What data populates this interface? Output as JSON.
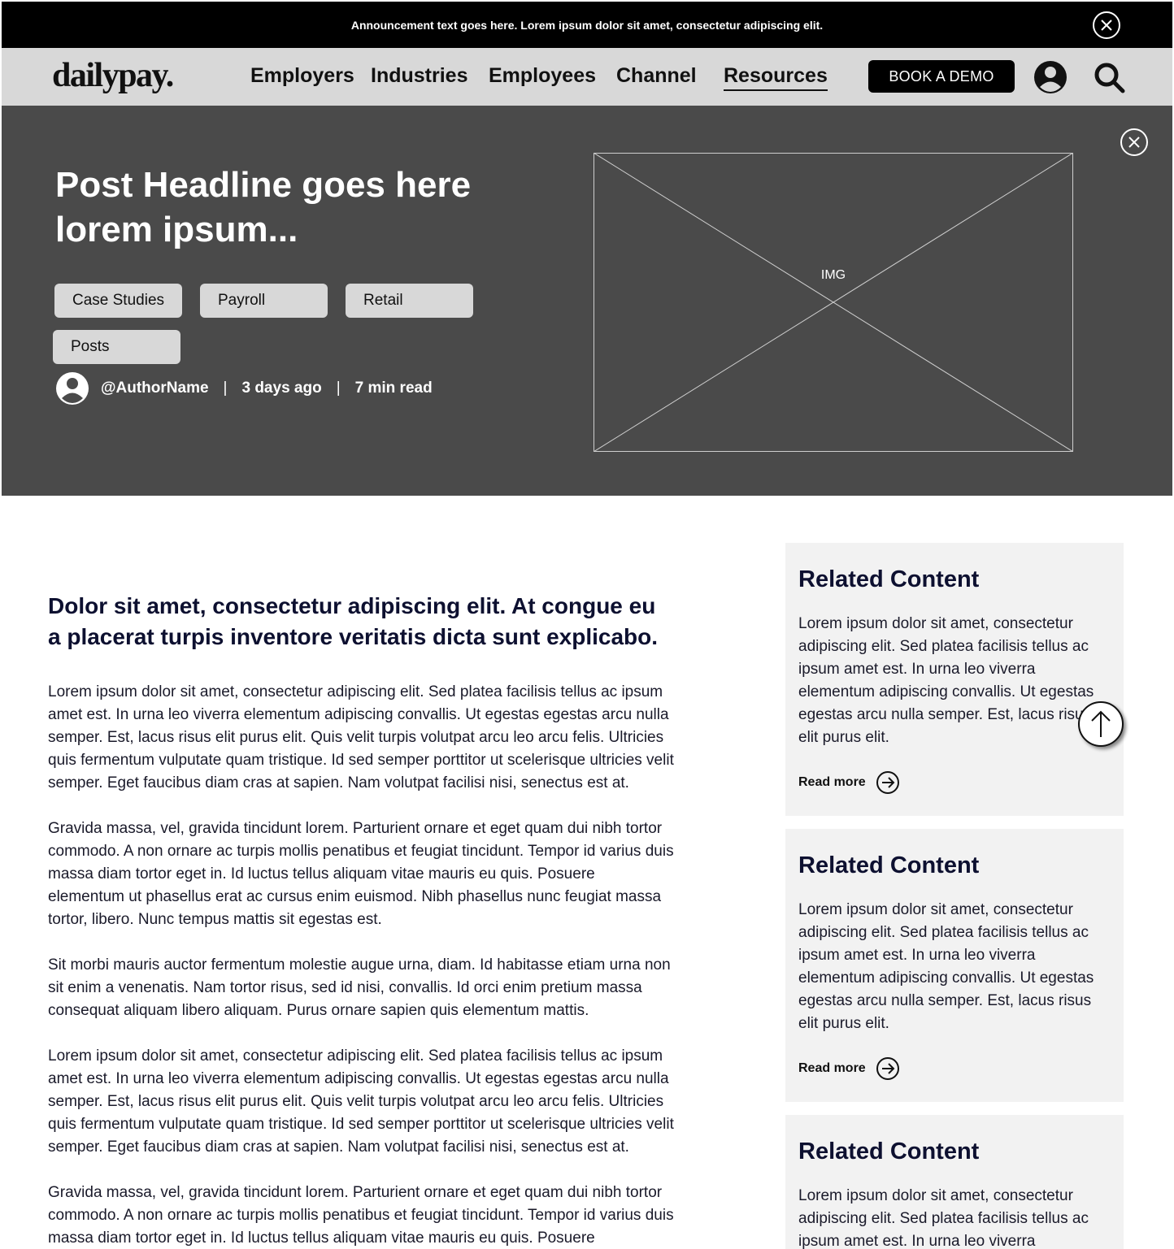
{
  "announcement": {
    "text": "Announcement text goes here. Lorem ipsum dolor sit amet, consectetur adipiscing elit."
  },
  "nav": {
    "logo": "dailypay.",
    "links": [
      "Employers",
      "Industries",
      "Employees",
      "Channel",
      "Resources"
    ],
    "active_link": "Resources",
    "cta_label": "BOOK A DEMO"
  },
  "hero": {
    "headline": "Post Headline goes here lorem ipsum...",
    "tags": [
      "Case Studies",
      "Payroll",
      "Retail",
      "Posts"
    ],
    "author": "@AuthorName",
    "posted": "3 days ago",
    "read_time": "7 min read",
    "image_label": "IMG"
  },
  "article": {
    "lead": "Dolor sit amet, consectetur adipiscing elit. At congue eu a placerat turpis inventore veritatis dicta sunt explicabo.",
    "paragraphs": [
      "Lorem ipsum dolor sit amet, consectetur adipiscing elit. Sed platea facilisis tellus ac ipsum amet est. In urna leo viverra elementum adipiscing convallis. Ut egestas egestas arcu nulla semper. Est, lacus risus elit purus elit. Quis velit turpis volutpat arcu leo arcu felis. Ultricies quis fermentum vulputate quam tristique. Id sed semper porttitor ut scelerisque ultricies velit semper. Eget faucibus diam cras at sapien. Nam volutpat facilisi nisi, senectus est at.",
      "Gravida massa, vel, gravida tincidunt lorem. Parturient ornare et eget quam dui nibh tortor commodo. A non ornare ac turpis mollis penatibus et feugiat tincidunt. Tempor id varius duis massa diam tortor eget in. Id luctus tellus aliquam vitae mauris eu quis. Posuere elementum ut phasellus erat ac cursus enim euismod. Nibh phasellus nunc feugiat massa tortor, libero. Nunc tempus mattis sit egestas est.",
      "Sit morbi mauris auctor fermentum molestie augue urna, diam. Id habitasse etiam urna non sit enim a venenatis. Nam tortor risus, sed id nisi, convallis. Id orci enim pretium massa consequat aliquam libero aliquam. Purus ornare sapien quis elementum mattis.",
      "Lorem ipsum dolor sit amet, consectetur adipiscing elit. Sed platea facilisis tellus ac ipsum amet est. In urna leo viverra elementum adipiscing convallis. Ut egestas egestas arcu nulla semper. Est, lacus risus elit purus elit. Quis velit turpis volutpat arcu leo arcu felis. Ultricies quis fermentum vulputate quam tristique. Id sed semper porttitor ut scelerisque ultricies velit semper. Eget faucibus diam cras at sapien. Nam volutpat facilisi nisi, senectus est at.",
      "Gravida massa, vel, gravida tincidunt lorem. Parturient ornare et eget quam dui nibh tortor commodo. A non ornare ac turpis mollis penatibus et feugiat tincidunt. Tempor id varius duis massa diam tortor eget in. Id luctus tellus aliquam vitae mauris eu quis. Posuere"
    ]
  },
  "sidebar": {
    "cards": [
      {
        "title": "Related Content",
        "text": "Lorem ipsum dolor sit amet, consectetur adipiscing elit. Sed platea facilisis tellus ac ipsum amet est. In urna leo viverra elementum adipiscing convallis. Ut egestas egestas arcu nulla semper. Est, lacus risus elit purus elit.",
        "link": "Read more"
      },
      {
        "title": "Related Content",
        "text": "Lorem ipsum dolor sit amet, consectetur adipiscing elit. Sed platea facilisis tellus ac ipsum amet est. In urna leo viverra elementum adipiscing convallis. Ut egestas egestas arcu nulla semper. Est, lacus risus elit purus elit.",
        "link": "Read more"
      },
      {
        "title": "Related Content",
        "text": "Lorem ipsum dolor sit amet, consectetur adipiscing elit. Sed platea facilisis tellus ac ipsum amet est. In urna leo viverra",
        "link": ""
      }
    ]
  },
  "icons": {
    "announcement_close": "close-icon",
    "user": "user-icon",
    "search": "search-icon",
    "hero_close": "close-icon",
    "author_avatar": "avatar-icon",
    "read_more": "arrow-right-circle-icon",
    "scroll_top": "arrow-up-icon"
  },
  "colors": {
    "announcement_bg": "#000000",
    "nav_bg": "#d8d8d8",
    "hero_bg": "#4a4a4a",
    "tag_bg": "#d8d8d8",
    "card_bg": "#f2f2f2",
    "heading": "#0d1030"
  }
}
